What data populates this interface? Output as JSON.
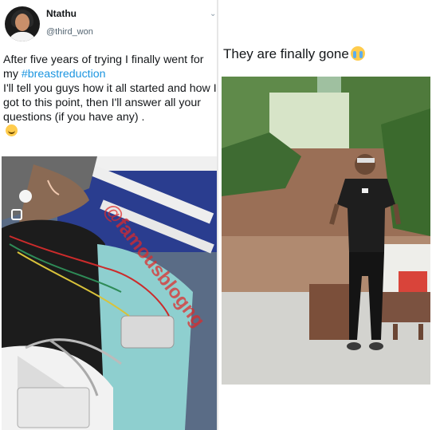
{
  "tweet": {
    "author_name": "Ntathu",
    "author_handle": "@third_won",
    "text_line1": "After five years of trying I finally went for my ",
    "hashtag": "#breastreduction",
    "text_line2": "I'll tell you guys how it all started and how I got to this point, then I'll answer all your questions (if you have any) ."
  },
  "right_panel": {
    "title": "They are finally gone"
  },
  "watermark": {
    "text": "@famousblogng"
  },
  "icons": {
    "chevron": "chevron-down-icon",
    "smile": "smiling-face-emoji",
    "cry": "loudly-crying-face-emoji"
  },
  "colors": {
    "hashtag": "#1b95e0",
    "watermark": "#e12828"
  }
}
